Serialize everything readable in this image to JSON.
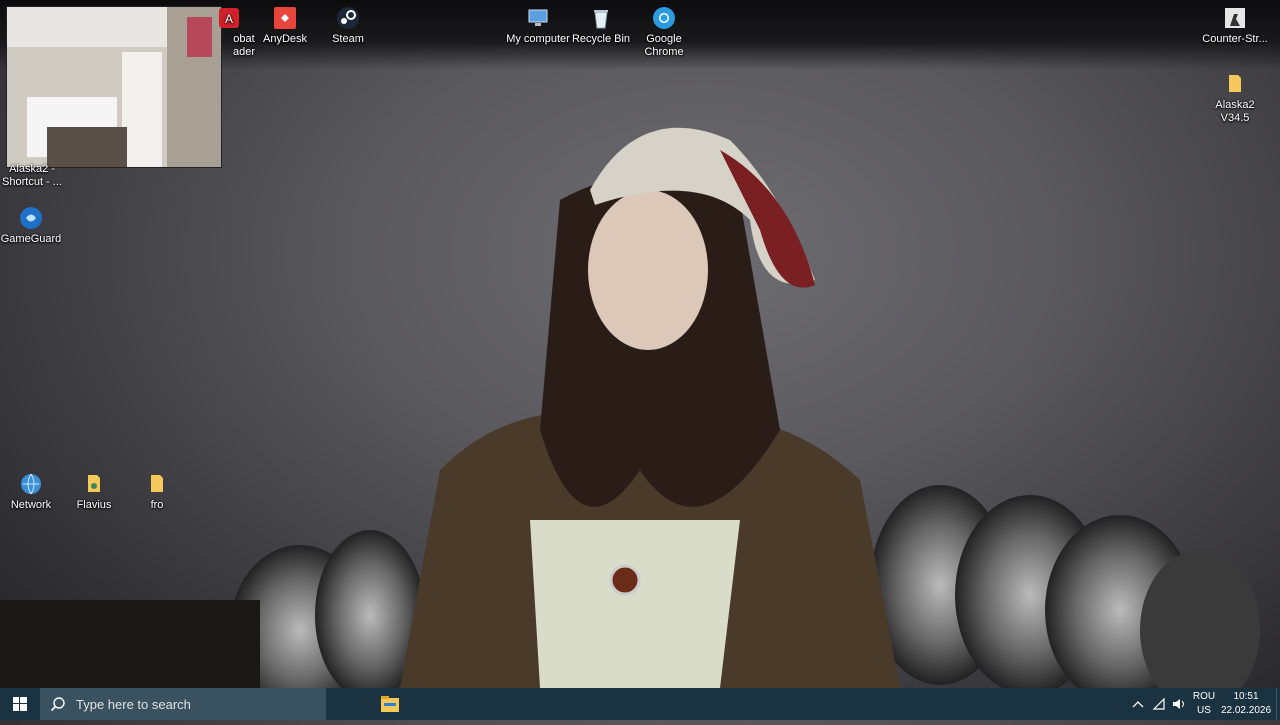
{
  "desktop": {
    "icons": [
      {
        "name": "acrobat-reader",
        "label": "obat\nader",
        "icon": "acrobat-icon"
      },
      {
        "name": "anydesk",
        "label": "AnyDesk",
        "icon": "anydesk-icon"
      },
      {
        "name": "steam",
        "label": "Steam",
        "icon": "steam-icon"
      },
      {
        "name": "my-computer",
        "label": "My computer",
        "icon": "computer-icon"
      },
      {
        "name": "recycle-bin",
        "label": "Recycle Bin",
        "icon": "recycle-bin-icon"
      },
      {
        "name": "google-chrome",
        "label": "Google Chrome",
        "icon": "chrome-icon"
      },
      {
        "name": "counter-strike",
        "label": "Counter-Str...",
        "icon": "counter-strike-icon"
      },
      {
        "name": "alaska2-folder",
        "label": "Alaska2 V34.5",
        "icon": "folder-icon"
      },
      {
        "name": "alaska2-shortcut",
        "label": "Alaska2 - Shortcut - ...",
        "icon": "shortcut-icon"
      },
      {
        "name": "gameguard",
        "label": "GameGuard",
        "icon": "gameguard-icon"
      },
      {
        "name": "network",
        "label": "Network",
        "icon": "network-icon"
      },
      {
        "name": "flavius",
        "label": "Flavius",
        "icon": "user-folder-icon"
      },
      {
        "name": "fro",
        "label": "fro",
        "icon": "folder-icon"
      }
    ]
  },
  "taskbar": {
    "search_placeholder": "Type here to search",
    "language_line1": "ROU",
    "language_line2": "US",
    "time": "10:51",
    "date": "22.02.2026",
    "tray_icons": [
      "chevron-up-icon",
      "network-icon",
      "volume-icon",
      "pen-icon"
    ]
  }
}
